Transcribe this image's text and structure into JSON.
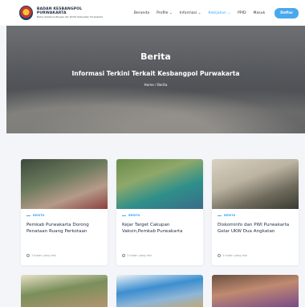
{
  "header": {
    "logo_title": "BADAN KESBANGPOL PURWAKARTA",
    "logo_sub": "Badan Kesatuan Bangsa dan Politik Kabupaten Purwakarta",
    "nav": [
      "Beranda",
      "Profile ⌄",
      "Informasi ⌄",
      "Kebijakan ⌄",
      "PPID",
      "Masuk"
    ],
    "active_nav_index": 3,
    "login_label": "Daftar"
  },
  "hero": {
    "title": "Berita",
    "subtitle": "Informasi Terkini Terkait Kesbangpol Purwakarta",
    "breadcrumb": "Home / Berita"
  },
  "cards": [
    {
      "tag": "BERITA",
      "title": "Pemkab Purwakarta Dorong Penataan Ruang Perkotaan",
      "meta": "1 bulan yang lalu"
    },
    {
      "tag": "BERITA",
      "title": "Kejar Target Cakupan Vaksin,Pemkab Purwakarta",
      "meta": "1 bulan yang lalu"
    },
    {
      "tag": "BERITA",
      "title": "Diskominfo dan PWI Purwakarta Gelar UKW Dua Angkatan",
      "meta": "1 bulan yang lalu"
    }
  ],
  "colors": {
    "accent": "#3fa9f5",
    "button": "#4aa8ec",
    "title_text": "#1f2a44"
  }
}
